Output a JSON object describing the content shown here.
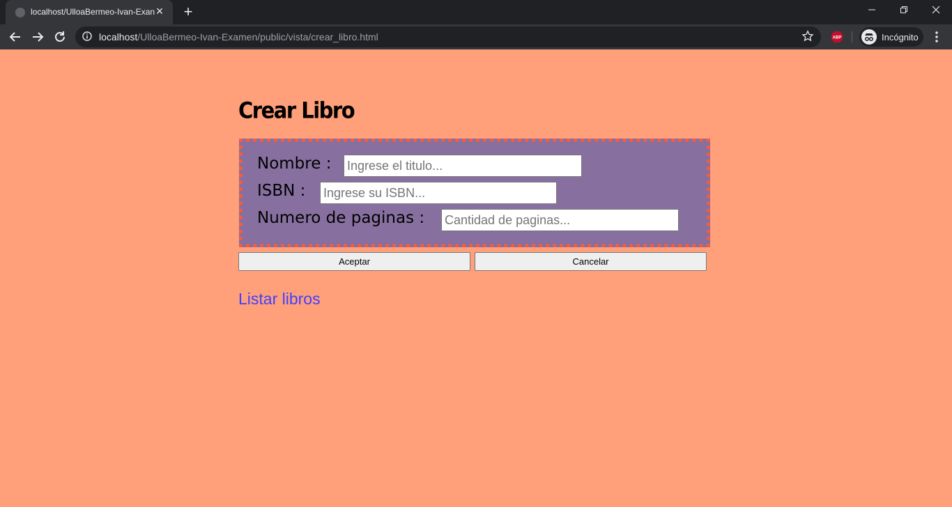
{
  "browser": {
    "tab_title": "localhost/UlloaBermeo-Ivan-Exan",
    "url_host": "localhost",
    "url_path": "/UlloaBermeo-Ivan-Examen/public/vista/crear_libro.html",
    "incognito_label": "Incógnito"
  },
  "page": {
    "title": "Crear Libro",
    "fields": [
      {
        "label": "Nombre :",
        "placeholder": "Ingrese el titulo...",
        "value": ""
      },
      {
        "label": "ISBN :",
        "placeholder": "Ingrese su ISBN...",
        "value": ""
      },
      {
        "label": "Numero de paginas :",
        "placeholder": "Cantidad de paginas...",
        "value": ""
      }
    ],
    "accept_label": "Aceptar",
    "cancel_label": "Cancelar",
    "list_link": "Listar libros"
  },
  "colors": {
    "background": "#ffa07a",
    "form_background": "#87709f",
    "form_border": "#ff5a36",
    "link": "#4040ff"
  },
  "icons": [
    "favicon-icon",
    "close-icon",
    "plus-icon",
    "minimize-icon",
    "restore-icon",
    "window-close-icon",
    "back-icon",
    "forward-icon",
    "reload-icon",
    "info-icon",
    "star-icon",
    "adblock-icon",
    "incognito-icon",
    "kebab-menu-icon"
  ]
}
